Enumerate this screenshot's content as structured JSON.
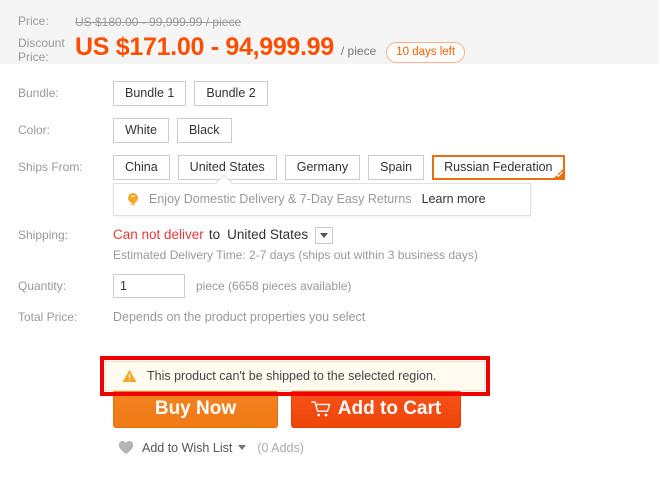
{
  "price_block": {
    "price_label": "Price:",
    "original_price": "US $180.00 - 99,999.99 / piece",
    "discount_label_line1": "Discount",
    "discount_label_line2": "Price:",
    "discount_price": "US $171.00 - 94,999.99",
    "per_unit": "/ piece",
    "days_left_badge": "10 days left",
    "background": "#f5f5f5",
    "accent_color": "#ff4e00"
  },
  "bundle": {
    "label": "Bundle:",
    "options": [
      "Bundle 1",
      "Bundle 2"
    ],
    "selected_index": -1
  },
  "color": {
    "label": "Color:",
    "options": [
      "White",
      "Black"
    ],
    "selected_index": -1
  },
  "ships_from": {
    "label": "Ships From:",
    "options": [
      "China",
      "United States",
      "Germany",
      "Spain",
      "Russian Federation"
    ],
    "selected_index": 4,
    "selected_value": "Russian Federation",
    "selected_border_color": "#e4700f"
  },
  "promo": {
    "icon": "lightbulb-icon",
    "text": "Enjoy Domestic Delivery & 7-Day Easy Returns",
    "link_label": "Learn more"
  },
  "shipping": {
    "label": "Shipping:",
    "status": "Can not deliver",
    "status_color": "#e4393c",
    "to_word": "to",
    "country": "United States",
    "dropdown_icon": "chevron-down-icon",
    "estimate": "Estimated Delivery Time: 2-7 days (ships out within 3 business days)"
  },
  "quantity": {
    "label": "Quantity:",
    "value": "1",
    "placeholder": "1",
    "unit_note": "piece (6658 pieces available)"
  },
  "total_price": {
    "label": "Total Price:",
    "text": "Depends on the product properties you select"
  },
  "error": {
    "icon": "warning-triangle-icon",
    "message": "This product can't be shipped to the selected region.",
    "highlight_color": "#f00000",
    "background": "#fffbf0"
  },
  "actions": {
    "buy_now_label": "Buy Now",
    "add_to_cart_label": "Add to Cart",
    "cart_icon": "shopping-cart-icon",
    "buy_now_color": "#f58220",
    "add_to_cart_color": "#f7521a"
  },
  "wishlist": {
    "icon": "heart-icon",
    "label": "Add to Wish List",
    "caret_icon": "chevron-down-icon",
    "count": "(0 Adds)"
  }
}
